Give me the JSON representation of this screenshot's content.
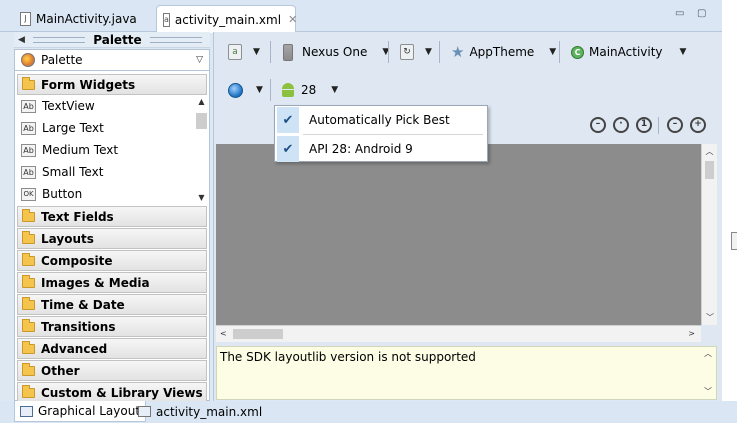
{
  "editor_tabs": [
    {
      "label": "MainActivity.java",
      "icon": "java-file-icon",
      "active": false
    },
    {
      "label": "activity_main.xml",
      "icon": "xml-file-icon",
      "active": true
    }
  ],
  "window_controls": {
    "minimize": "▭",
    "maximize": "▢"
  },
  "palette": {
    "title": "Palette",
    "selector_label": "Palette",
    "open_category": "Form Widgets",
    "widgets": [
      {
        "icon_text": "Ab",
        "label": "TextView"
      },
      {
        "icon_text": "Ab",
        "label": "Large Text"
      },
      {
        "icon_text": "Ab",
        "label": "Medium Text"
      },
      {
        "icon_text": "Ab",
        "label": "Small Text"
      },
      {
        "icon_text": "OK",
        "label": "Button"
      }
    ],
    "categories": [
      "Text Fields",
      "Layouts",
      "Composite",
      "Images & Media",
      "Time & Date",
      "Transitions",
      "Advanced",
      "Other",
      "Custom & Library Views"
    ]
  },
  "toolbar": {
    "device": "Nexus One",
    "theme": "AppTheme",
    "activity": "MainActivity",
    "api_level": "28",
    "activity_icon_text": "C"
  },
  "api_menu": {
    "items": [
      {
        "label": "Automatically Pick Best",
        "checked": true
      },
      {
        "label": "API 28: Android 9",
        "checked": true
      }
    ]
  },
  "zoom_controls": [
    "zoom-out-fit-icon",
    "zoom-real-size-icon",
    "zoom-100-icon",
    "zoom-out-icon",
    "zoom-in-icon"
  ],
  "message": {
    "text": "The SDK layoutlib version is not supported"
  },
  "bottom_tabs": [
    {
      "label": "Graphical Layout",
      "active": true
    },
    {
      "label": "activity_main.xml",
      "active": false
    }
  ],
  "colors": {
    "canvas": "#8c8c8c",
    "message_bg": "#fdfde6",
    "selection": "#cfe3f7"
  }
}
